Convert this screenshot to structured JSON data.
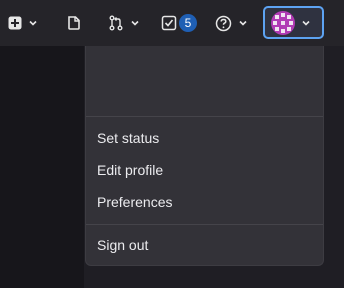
{
  "colors": {
    "topbar_bg": "#252429",
    "page_bg": "#1f1e24",
    "dropdown_bg": "#333238",
    "badge_bg": "#1f5fb4",
    "focus_ring": "#5da3f2",
    "avatar_primary": "#b13bb5"
  },
  "toolbar": {
    "items": [
      {
        "name": "create-new",
        "icon": "plus-square-icon",
        "has_dropdown": true
      },
      {
        "name": "issues",
        "icon": "issue-icon",
        "has_dropdown": false
      },
      {
        "name": "merge-requests",
        "icon": "merge-request-icon",
        "has_dropdown": true
      },
      {
        "name": "todos",
        "icon": "todo-checkbox-icon",
        "badge": "5"
      },
      {
        "name": "help",
        "icon": "help-circle-icon",
        "has_dropdown": true
      },
      {
        "name": "user-menu",
        "icon": "user-avatar",
        "has_dropdown": true
      }
    ]
  },
  "user_menu": {
    "items": [
      {
        "label": "Set status"
      },
      {
        "label": "Edit profile"
      },
      {
        "label": "Preferences"
      }
    ],
    "sign_out": "Sign out"
  }
}
